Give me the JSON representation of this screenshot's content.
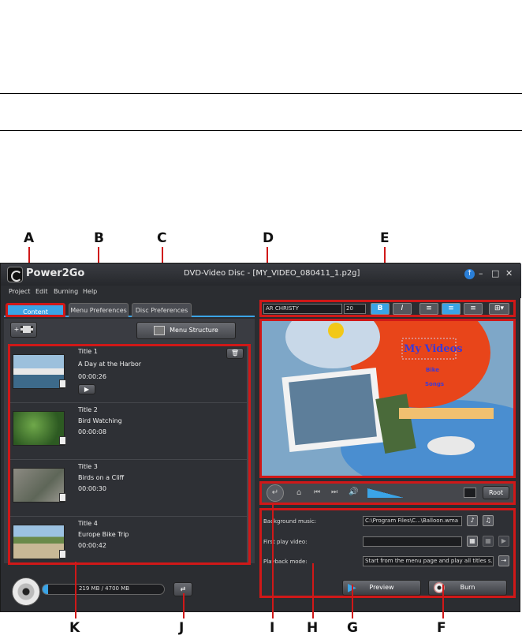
{
  "app": {
    "name": "Power2Go",
    "window_title": "DVD-Video Disc - [MY_VIDEO_080411_1.p2g]"
  },
  "menubar": {
    "items": [
      "Project",
      "Edit",
      "Burning",
      "Help"
    ]
  },
  "tabs": [
    "Content",
    "Menu Preferences",
    "Disc Preferences"
  ],
  "left_panel": {
    "add_button_label": "+",
    "menu_structure_label": "Menu Structure",
    "titles": [
      {
        "number": "Title 1",
        "name": "A Day at the Harbor",
        "duration": "00:00:26"
      },
      {
        "number": "Title 2",
        "name": "Bird Watching",
        "duration": "00:00:08"
      },
      {
        "number": "Title 3",
        "name": "Birds on a Cliff",
        "duration": "00:00:30"
      },
      {
        "number": "Title 4",
        "name": "Europe Bike Trip",
        "duration": "00:00:42"
      }
    ]
  },
  "format_toolbar": {
    "font": "AR CHRISTY",
    "size": "20",
    "bold": "B",
    "italic": "I"
  },
  "preview": {
    "menu_title": "My Videos",
    "menu_item_1": "Bike",
    "menu_item_2": "Songs"
  },
  "player": {
    "root_label": "Root"
  },
  "settings": {
    "background_music_label": "Background music:",
    "background_music_value": "C:\\Program Files\\C...\\Balloon.wma",
    "first_play_label": "First play video:",
    "first_play_value": "",
    "playback_label": "Playback mode:",
    "playback_value": "Start from the menu page and play all titles s..."
  },
  "bottom": {
    "capacity_text": "219 MB / 4700 MB",
    "capacity_fraction": 0.047,
    "preview_label": "Preview",
    "burn_label": "Burn"
  },
  "callouts": {
    "top": [
      "A",
      "B",
      "C",
      "D",
      "E"
    ],
    "bottom": [
      "K",
      "J",
      "I",
      "H",
      "G",
      "F"
    ]
  },
  "colors": {
    "accent": "#3ba4e6",
    "highlight": "#d01818"
  }
}
